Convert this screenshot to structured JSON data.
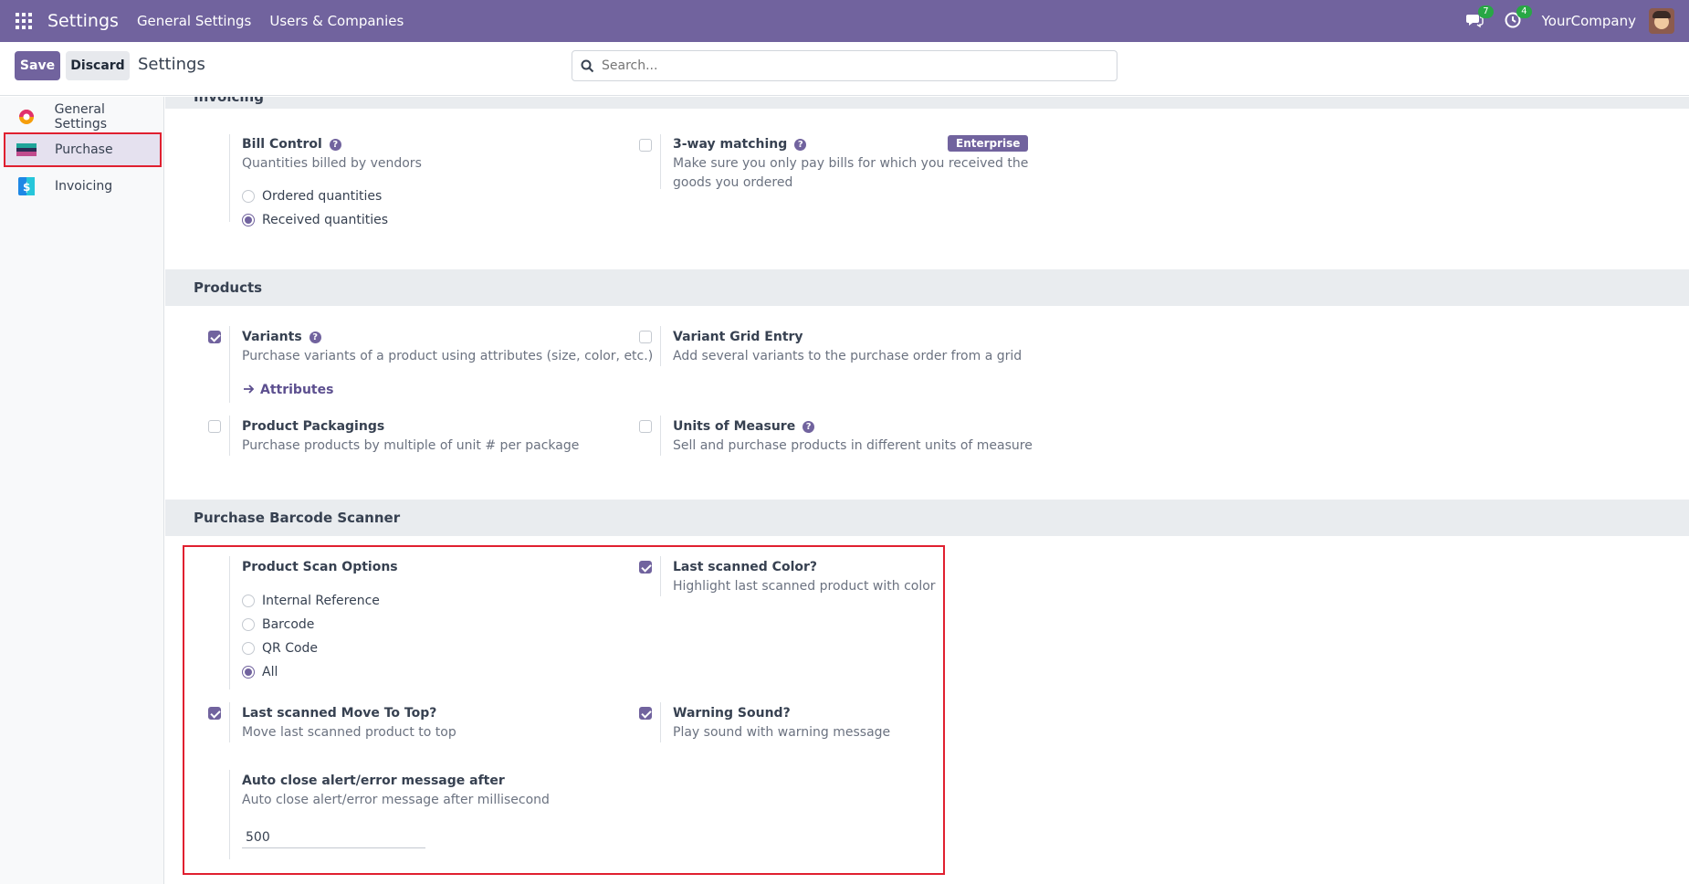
{
  "navbar": {
    "app_name": "Settings",
    "menu": [
      "General Settings",
      "Users & Companies"
    ],
    "messages_count": "7",
    "activities_count": "4",
    "company": "YourCompany"
  },
  "control": {
    "save_label": "Save",
    "discard_label": "Discard",
    "breadcrumb": "Settings",
    "search_placeholder": "Search..."
  },
  "sidebar": {
    "items": [
      {
        "label": "General Settings",
        "icon": "general-settings-icon"
      },
      {
        "label": "Purchase",
        "icon": "purchase-icon",
        "active": true
      },
      {
        "label": "Invoicing",
        "icon": "invoicing-icon"
      }
    ]
  },
  "sections": {
    "invoicing": {
      "title": "Invoicing",
      "bill_control": {
        "title": "Bill Control",
        "desc": "Quantities billed by vendors",
        "options": [
          "Ordered quantities",
          "Received quantities"
        ],
        "selected": "Received quantities"
      },
      "three_way": {
        "title": "3-way matching",
        "desc": "Make sure you only pay bills for which you received the goods you ordered",
        "badge": "Enterprise",
        "checked": false
      }
    },
    "products": {
      "title": "Products",
      "variants": {
        "title": "Variants",
        "desc": "Purchase variants of a product using attributes (size, color, etc.)",
        "link": "Attributes",
        "checked": true
      },
      "grid": {
        "title": "Variant Grid Entry",
        "desc": "Add several variants to the purchase order from a grid",
        "checked": false
      },
      "packagings": {
        "title": "Product Packagings",
        "desc": "Purchase products by multiple of unit # per package",
        "checked": false
      },
      "uom": {
        "title": "Units of Measure",
        "desc": "Sell and purchase products in different units of measure",
        "checked": false
      }
    },
    "barcode": {
      "title": "Purchase Barcode Scanner",
      "scan_options": {
        "title": "Product Scan Options",
        "options": [
          "Internal Reference",
          "Barcode",
          "QR Code",
          "All"
        ],
        "selected": "All"
      },
      "last_color": {
        "title": "Last scanned Color?",
        "desc": "Highlight last scanned product with color",
        "checked": true
      },
      "move_top": {
        "title": "Last scanned Move To Top?",
        "desc": "Move last scanned product to top",
        "checked": true
      },
      "warning_sound": {
        "title": "Warning Sound?",
        "desc": "Play sound with warning message",
        "checked": true
      },
      "auto_close": {
        "title": "Auto close alert/error message after",
        "desc": "Auto close alert/error message after millisecond",
        "value": "500"
      }
    }
  },
  "colors": {
    "brand": "#71639e",
    "highlight": "#e02030",
    "badge_green": "#28a745"
  }
}
